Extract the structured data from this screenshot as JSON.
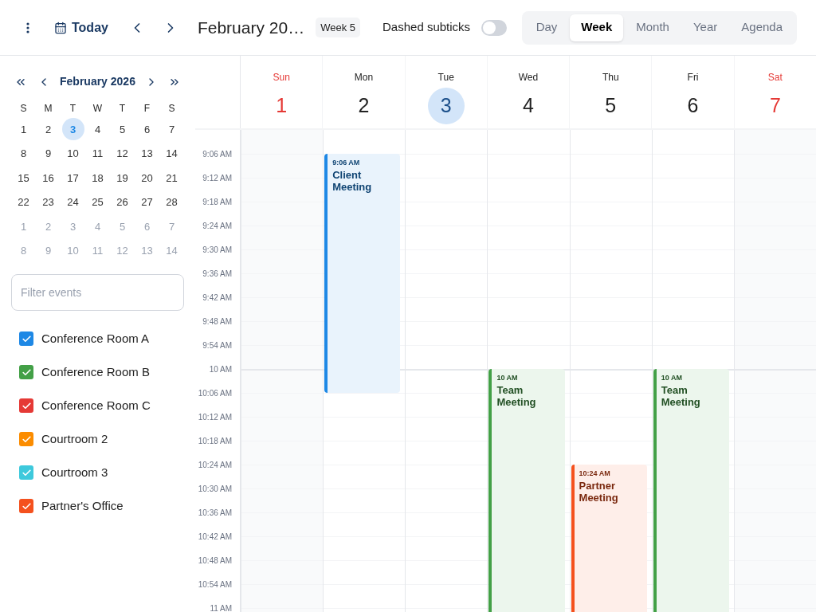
{
  "toolbar": {
    "today": "Today",
    "title": "February 20…",
    "week_badge": "Week 5",
    "toggle": {
      "label": "Dashed subticks",
      "on": false
    },
    "views": [
      {
        "label": "Day",
        "selected": false
      },
      {
        "label": "Week",
        "selected": true
      },
      {
        "label": "Month",
        "selected": false
      },
      {
        "label": "Year",
        "selected": false
      },
      {
        "label": "Agenda",
        "selected": false
      }
    ]
  },
  "mini_calendar": {
    "title": "February 2026",
    "weekdays": [
      "S",
      "M",
      "T",
      "W",
      "T",
      "F",
      "S"
    ],
    "weeks": [
      [
        {
          "label": "1",
          "selected": false,
          "outside": false
        },
        {
          "label": "2",
          "selected": false,
          "outside": false
        },
        {
          "label": "3",
          "selected": true,
          "outside": false
        },
        {
          "label": "4",
          "selected": false,
          "outside": false
        },
        {
          "label": "5",
          "selected": false,
          "outside": false
        },
        {
          "label": "6",
          "selected": false,
          "outside": false
        },
        {
          "label": "7",
          "selected": false,
          "outside": false
        }
      ],
      [
        {
          "label": "8",
          "selected": false,
          "outside": false
        },
        {
          "label": "9",
          "selected": false,
          "outside": false
        },
        {
          "label": "10",
          "selected": false,
          "outside": false
        },
        {
          "label": "11",
          "selected": false,
          "outside": false
        },
        {
          "label": "12",
          "selected": false,
          "outside": false
        },
        {
          "label": "13",
          "selected": false,
          "outside": false
        },
        {
          "label": "14",
          "selected": false,
          "outside": false
        }
      ],
      [
        {
          "label": "15",
          "selected": false,
          "outside": false
        },
        {
          "label": "16",
          "selected": false,
          "outside": false
        },
        {
          "label": "17",
          "selected": false,
          "outside": false
        },
        {
          "label": "18",
          "selected": false,
          "outside": false
        },
        {
          "label": "19",
          "selected": false,
          "outside": false
        },
        {
          "label": "20",
          "selected": false,
          "outside": false
        },
        {
          "label": "21",
          "selected": false,
          "outside": false
        }
      ],
      [
        {
          "label": "22",
          "selected": false,
          "outside": false
        },
        {
          "label": "23",
          "selected": false,
          "outside": false
        },
        {
          "label": "24",
          "selected": false,
          "outside": false
        },
        {
          "label": "25",
          "selected": false,
          "outside": false
        },
        {
          "label": "26",
          "selected": false,
          "outside": false
        },
        {
          "label": "27",
          "selected": false,
          "outside": false
        },
        {
          "label": "28",
          "selected": false,
          "outside": false
        }
      ],
      [
        {
          "label": "1",
          "selected": false,
          "outside": true
        },
        {
          "label": "2",
          "selected": false,
          "outside": true
        },
        {
          "label": "3",
          "selected": false,
          "outside": true
        },
        {
          "label": "4",
          "selected": false,
          "outside": true
        },
        {
          "label": "5",
          "selected": false,
          "outside": true
        },
        {
          "label": "6",
          "selected": false,
          "outside": true
        },
        {
          "label": "7",
          "selected": false,
          "outside": true
        }
      ],
      [
        {
          "label": "8",
          "selected": false,
          "outside": true
        },
        {
          "label": "9",
          "selected": false,
          "outside": true
        },
        {
          "label": "10",
          "selected": false,
          "outside": true
        },
        {
          "label": "11",
          "selected": false,
          "outside": true
        },
        {
          "label": "12",
          "selected": false,
          "outside": true
        },
        {
          "label": "13",
          "selected": false,
          "outside": true
        },
        {
          "label": "14",
          "selected": false,
          "outside": true
        }
      ]
    ]
  },
  "filter": {
    "placeholder": "Filter events"
  },
  "calendars": [
    {
      "label": "Conference Room A",
      "checked": true,
      "color": "#1e88e5"
    },
    {
      "label": "Conference Room B",
      "checked": true,
      "color": "#43a047"
    },
    {
      "label": "Conference Room C",
      "checked": true,
      "color": "#e53935"
    },
    {
      "label": "Courtroom 2",
      "checked": true,
      "color": "#fb8c00"
    },
    {
      "label": "Courtroom 3",
      "checked": true,
      "color": "#3ec9dc"
    },
    {
      "label": "Partner's Office",
      "checked": true,
      "color": "#f4511e"
    }
  ],
  "days": [
    {
      "name": "Sun",
      "date": "1",
      "weekend": true,
      "today": false
    },
    {
      "name": "Mon",
      "date": "2",
      "weekend": false,
      "today": false,
      "events": [
        {
          "time": "9:06 AM",
          "title": "Client Meeting",
          "color": "#1e88e5"
        }
      ]
    },
    {
      "name": "Tue",
      "date": "3",
      "weekend": false,
      "today": true
    },
    {
      "name": "Wed",
      "date": "4",
      "weekend": false,
      "today": false,
      "events": [
        {
          "time": "10 AM",
          "title": "Team Meeting",
          "color": "#43a047"
        }
      ]
    },
    {
      "name": "Thu",
      "date": "5",
      "weekend": false,
      "today": false,
      "events": [
        {
          "time": "10:24 AM",
          "title": "Partner Meeting",
          "color": "#f4511e"
        }
      ]
    },
    {
      "name": "Fri",
      "date": "6",
      "weekend": false,
      "today": false,
      "events": [
        {
          "time": "10 AM",
          "title": "Team Meeting",
          "color": "#43a047"
        }
      ]
    },
    {
      "name": "Sat",
      "date": "7",
      "weekend": true,
      "today": false
    }
  ],
  "time_labels": [
    "9:06 AM",
    "9:12 AM",
    "9:18 AM",
    "9:24 AM",
    "9:30 AM",
    "9:36 AM",
    "9:42 AM",
    "9:48 AM",
    "9:54 AM",
    "10 AM",
    "10:06 AM",
    "10:12 AM",
    "10:18 AM",
    "10:24 AM",
    "10:30 AM",
    "10:36 AM",
    "10:42 AM",
    "10:48 AM",
    "10:54 AM",
    "11 AM"
  ]
}
